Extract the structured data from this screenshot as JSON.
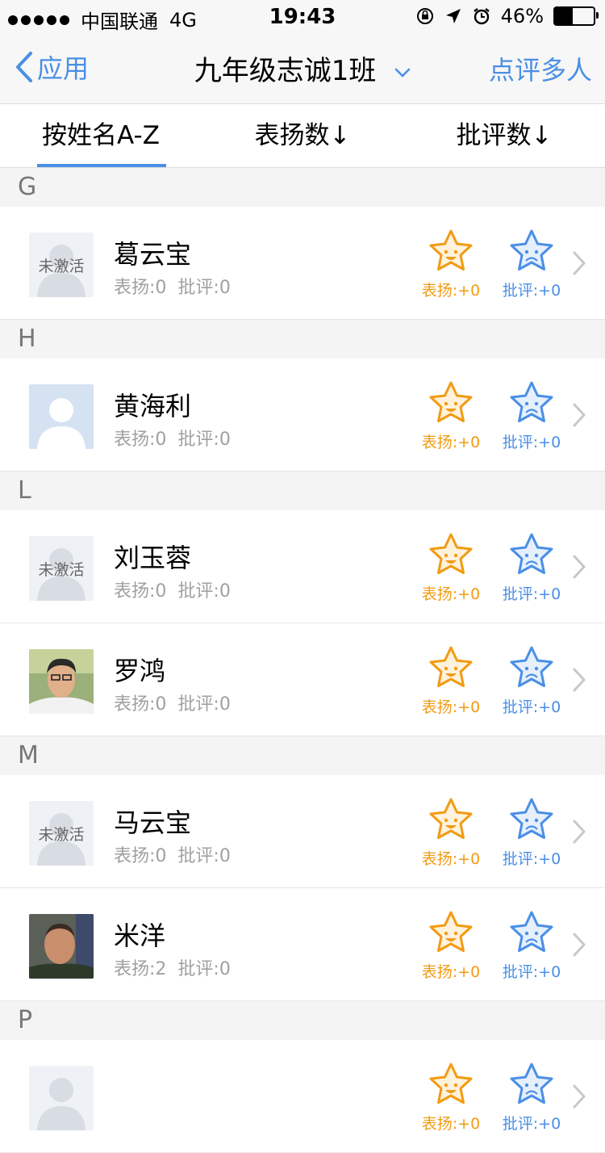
{
  "status": {
    "carrier": "中国联通",
    "network": "4G",
    "time": "19:43",
    "battery": "46%",
    "battery_level": 0.46
  },
  "nav": {
    "back_label": "应用",
    "title": "九年级志诚1班",
    "right_label": "点评多人"
  },
  "tabs": [
    "按姓名A-Z",
    "表扬数↓",
    "批评数↓"
  ],
  "colors": {
    "accent": "#4a8fe6",
    "praise": "#f29b13"
  },
  "sections": [
    {
      "letter": "G",
      "students": [
        {
          "name": "葛云宝",
          "praise": "表扬:0",
          "critic": "批评:0",
          "avatar": "inactive",
          "avatar_label": "未激活"
        }
      ]
    },
    {
      "letter": "H",
      "students": [
        {
          "name": "黄海利",
          "praise": "表扬:0",
          "critic": "批评:0",
          "avatar": "default",
          "avatar_label": ""
        }
      ]
    },
    {
      "letter": "L",
      "students": [
        {
          "name": "刘玉蓉",
          "praise": "表扬:0",
          "critic": "批评:0",
          "avatar": "inactive",
          "avatar_label": "未激活"
        },
        {
          "name": "罗鸿",
          "praise": "表扬:0",
          "critic": "批评:0",
          "avatar": "photo1",
          "avatar_label": ""
        }
      ]
    },
    {
      "letter": "M",
      "students": [
        {
          "name": "马云宝",
          "praise": "表扬:0",
          "critic": "批评:0",
          "avatar": "inactive",
          "avatar_label": "未激活"
        },
        {
          "name": "米洋",
          "praise": "表扬:2",
          "critic": "批评:0",
          "avatar": "photo2",
          "avatar_label": ""
        }
      ]
    },
    {
      "letter": "P",
      "students": [
        {
          "name": "",
          "praise": "",
          "critic": "",
          "avatar": "inactive",
          "avatar_label": ""
        }
      ]
    }
  ],
  "actions": {
    "praise_label": "表扬:+0",
    "critic_label": "批评:+0"
  }
}
